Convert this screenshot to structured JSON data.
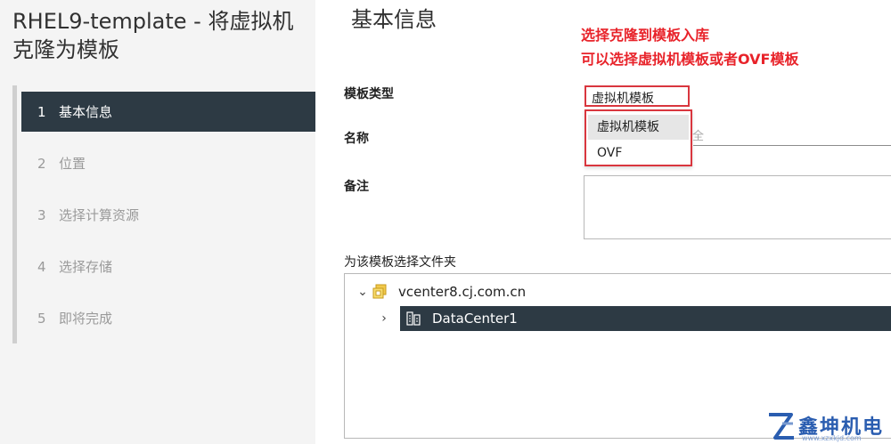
{
  "dialog": {
    "title": "RHEL9-template - 将虚拟机克隆为模板"
  },
  "steps": [
    {
      "num": "1",
      "label": "基本信息",
      "active": true
    },
    {
      "num": "2",
      "label": "位置"
    },
    {
      "num": "3",
      "label": "选择计算资源"
    },
    {
      "num": "4",
      "label": "选择存储"
    },
    {
      "num": "5",
      "label": "即将完成"
    }
  ],
  "section": {
    "title": "基本信息"
  },
  "annotation": {
    "line1": "选择克隆到模板入库",
    "line2": "可以选择虚拟机模板或者OVF模板"
  },
  "form": {
    "template_type_label": "模板类型",
    "template_type_value": "虚拟机模板",
    "dropdown_options": [
      "虚拟机模板",
      "OVF"
    ],
    "name_label": "名称",
    "name_partial": "全",
    "notes_label": "备注",
    "folder_label": "为该模板选择文件夹"
  },
  "tree": {
    "root": {
      "label": "vcenter8.cj.com.cn",
      "expanded": true
    },
    "child": {
      "label": "DataCenter1",
      "selected": true
    }
  },
  "watermark": {
    "text": "鑫坤机电",
    "url": "www.xzxkjd.com"
  },
  "colors": {
    "accent_dark": "#2d3a44",
    "annotation_red": "#e8232a",
    "highlight_border": "#d9363e",
    "watermark_blue": "#2a5db0"
  }
}
